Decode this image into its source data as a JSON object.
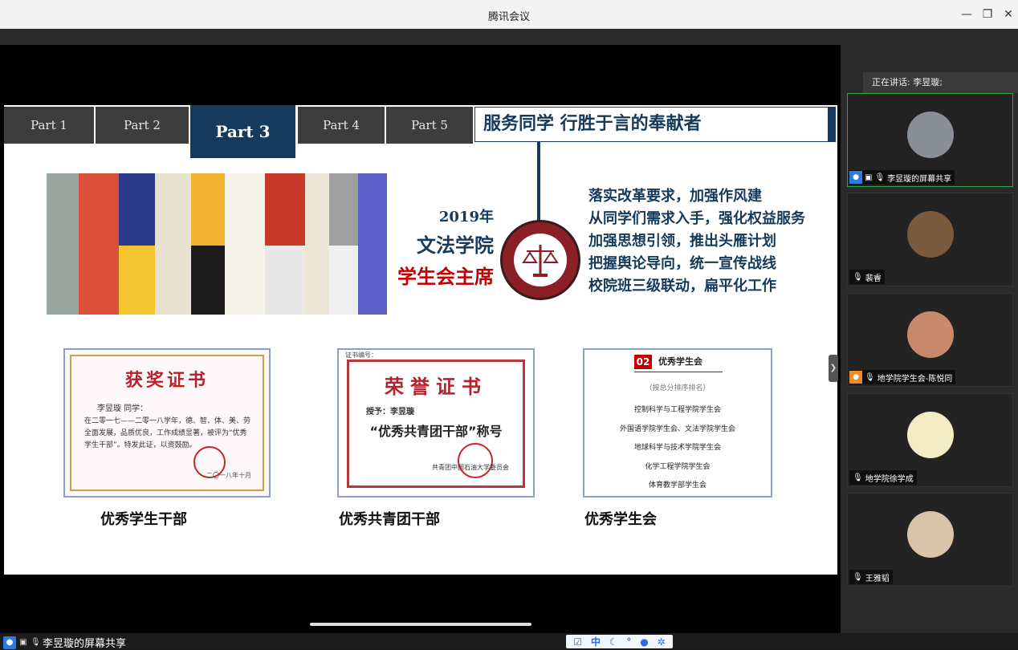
{
  "window": {
    "title": "腾讯会议",
    "minimize": "—",
    "restore": "❐",
    "close": "✕"
  },
  "slide": {
    "tabs": [
      "Part 1",
      "Part 2",
      "Part 3",
      "Part 4",
      "Part 5"
    ],
    "active_tab": "Part 3",
    "headline": "服务同学 行胜于言的奉献者",
    "year": "2019年",
    "college": "文法学院",
    "role": "学生会主席",
    "duties": [
      "落实改革要求，加强作风建",
      "从同学们需求入手，强化权益服务",
      "加强思想引领，推出头雁计划",
      "把握舆论导向，统一宣传战线",
      "校院班三级联动，扁平化工作"
    ],
    "certificates": [
      {
        "title": "获奖证书",
        "name": "李昱璇 同学：",
        "body": "在二零一七——二零一八学年，德、智、体、美、劳全面发展，品质优良，工作成绩显著，被评为“优秀学生干部”。特发此证，以资鼓励。",
        "date": "二〇一八年十月",
        "caption": "优秀学生干部"
      },
      {
        "header": "证书编号：",
        "title": "荣誉证书",
        "to": "授予：李昱璇",
        "honor": "“优秀共青团干部”称号",
        "org": "共青团中国石油大学委员会",
        "caption": "优秀共青团干部"
      },
      {
        "badge": "02",
        "title": "优秀学生会",
        "sub": "（按总分排序排名）",
        "list": [
          "控制科学与工程学院学生会",
          "外国语学院学生会、文法学院学生会",
          "地球科学与技术学院学生会",
          "化学工程学院学生会",
          "体育教学部学生会"
        ],
        "caption": "优秀学生会"
      }
    ]
  },
  "sidebar": {
    "speaking_label": "正在讲话: 李昱璇;",
    "participants": [
      {
        "name": "李昱璇的屏幕共享",
        "avatar_color": "#8a8e96",
        "active": true,
        "badge": "person-icon",
        "badge_color": "#2d7be0"
      },
      {
        "name": "裴睿",
        "avatar_color": "#7a5a3c",
        "active": false,
        "badge": "",
        "badge_color": ""
      },
      {
        "name": "地学院学生会-陈悦同",
        "avatar_color": "#c88a6a",
        "active": false,
        "badge": "person-icon",
        "badge_color": "#f08a24"
      },
      {
        "name": "地学院徐学成",
        "avatar_color": "#f3ecc4",
        "active": false,
        "badge": "",
        "badge_color": ""
      },
      {
        "name": "王雅韬",
        "avatar_color": "#d8c4a8",
        "active": false,
        "badge": "",
        "badge_color": ""
      }
    ]
  },
  "statusbar": {
    "share_label": "李昱璇的屏幕共享",
    "ime_mode": "中"
  }
}
